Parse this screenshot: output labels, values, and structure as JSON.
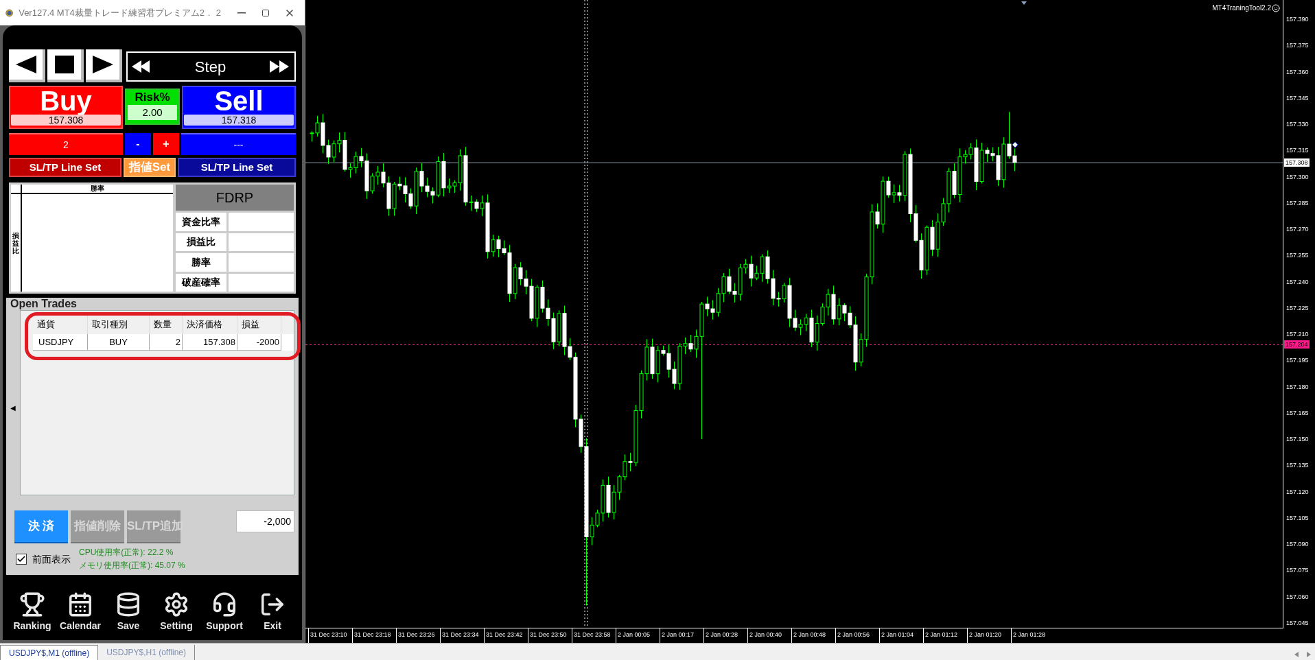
{
  "window": {
    "title": "Ver127.4 MT4裁量トレード練習君プレミアム2． 2"
  },
  "controls": {
    "step_label": "Step",
    "buy": {
      "label": "Buy",
      "price": "157.308"
    },
    "risk": {
      "label": "Risk%",
      "value": "2.00"
    },
    "sell": {
      "label": "Sell",
      "price": "157.318"
    },
    "buy_lots": "2",
    "minus": "-",
    "plus": "+",
    "sell_lots": "---",
    "line_buttons": [
      {
        "label": "SL/TP Line Set",
        "kind": "buy"
      },
      {
        "label": "指値Set",
        "kind": "limit"
      },
      {
        "label": "SL/TP Line Set",
        "kind": "sell"
      }
    ]
  },
  "stats": {
    "matrix_x_label": "勝率",
    "matrix_y_label": "損益比",
    "title": "FDRP",
    "rows": [
      "資金比率",
      "損益比",
      "勝率",
      "破産確率"
    ]
  },
  "open_trades": {
    "title": "Open Trades",
    "collapse_arrow": "◀",
    "highlighted": true,
    "columns": [
      "通貨",
      "取引種別",
      "数量",
      "決済価格",
      "損益"
    ],
    "rows": [
      [
        "USDJPY",
        "BUY",
        "2",
        "157.308",
        "-2000"
      ]
    ]
  },
  "actions": {
    "buttons": [
      {
        "label": "決 済",
        "disabled": false
      },
      {
        "label": "指値削除",
        "disabled": true
      },
      {
        "label": "SL/TP追加",
        "disabled": true
      }
    ],
    "total": "-2,000"
  },
  "always_on_top": {
    "label": "前面表示",
    "checked": true
  },
  "usage": [
    "CPU使用率(正常): 22.2 %",
    "メモリ使用率(正常): 45.07 %"
  ],
  "toolbar": [
    {
      "label": "Ranking",
      "kind": "ranking"
    },
    {
      "label": "Calendar",
      "kind": "calendar"
    },
    {
      "label": "Save",
      "kind": "save"
    },
    {
      "label": "Setting",
      "kind": "setting"
    },
    {
      "label": "Support",
      "kind": "support"
    },
    {
      "label": "Exit",
      "kind": "exit"
    }
  ],
  "chart": {
    "tool_label": "MT4TraningTool2.2",
    "price_ticks": [
      "157.390",
      "157.375",
      "157.360",
      "157.345",
      "157.330",
      "157.315",
      "157.300",
      "157.285",
      "157.270",
      "157.255",
      "157.240",
      "157.225",
      "157.210",
      "157.195",
      "157.180",
      "157.165",
      "157.150",
      "157.135",
      "157.120",
      "157.105",
      "157.090",
      "157.075",
      "157.060",
      "157.045"
    ],
    "bid_tag": "157.308",
    "order_tag": "157.204",
    "time_labels": [
      "31 Dec 23:10",
      "31 Dec 23:18",
      "31 Dec 23:26",
      "31 Dec 23:34",
      "31 Dec 23:42",
      "31 Dec 23:50",
      "31 Dec 23:58",
      "2 Jan 00:05",
      "2 Jan 00:17",
      "2 Jan 00:28",
      "2 Jan 00:40",
      "2 Jan 00:48",
      "2 Jan 00:56",
      "2 Jan 01:04",
      "2 Jan 01:12",
      "2 Jan 01:20",
      "2 Jan 01:28"
    ]
  },
  "chart_tabs": [
    {
      "label": "USDJPY$,M1 (offline)",
      "selected": true
    },
    {
      "label": "USDJPY$,H1 (offline)",
      "selected": false
    }
  ]
}
